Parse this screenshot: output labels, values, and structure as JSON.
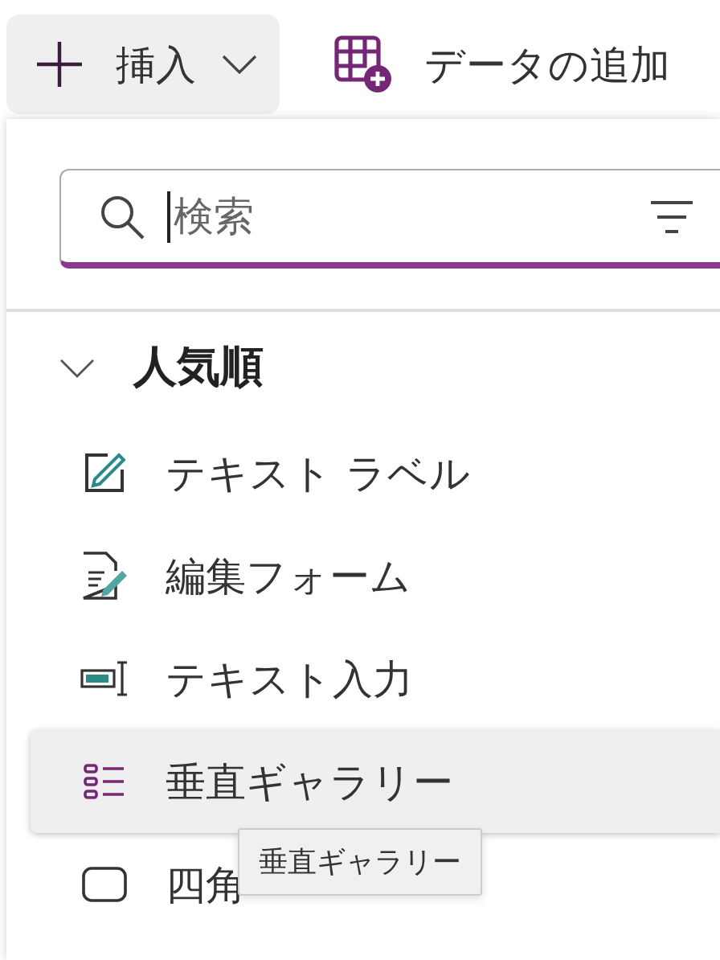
{
  "toolbar": {
    "buttons": [
      {
        "label": "挿入",
        "kind": "insert",
        "pressed": true
      },
      {
        "label": "データの追加",
        "kind": "data",
        "pressed": false
      }
    ]
  },
  "insert_menu": {
    "search": {
      "placeholder": "検索"
    },
    "section": {
      "title": "人気順",
      "expanded": true
    },
    "items": [
      {
        "label": "テキスト ラベル",
        "kind": "label",
        "selected": false
      },
      {
        "label": "編集フォーム",
        "kind": "form",
        "selected": false
      },
      {
        "label": "テキスト入力",
        "kind": "input",
        "selected": false
      },
      {
        "label": "垂直ギャラリー",
        "kind": "gallery",
        "selected": true
      },
      {
        "label": "四角",
        "kind": "rectangle",
        "selected": false
      }
    ],
    "tooltip": "垂直ギャラリー"
  }
}
